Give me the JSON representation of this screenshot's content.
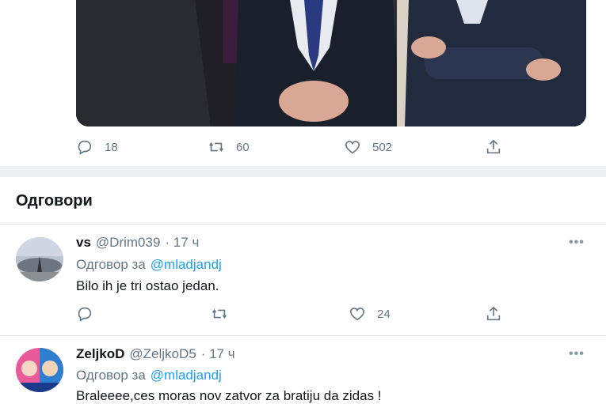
{
  "top_tweet": {
    "stats": {
      "replies": "18",
      "retweets": "60",
      "likes": "502"
    }
  },
  "section": {
    "title": "Одговори"
  },
  "replies": [
    {
      "name": "vs",
      "handle": "@Drim039",
      "time": "· 17 ч",
      "reply_prefix": "Одговор за",
      "reply_to": "@mladjandj",
      "text": "Bilo ih je tri ostao jedan.",
      "likes": "24"
    },
    {
      "name": "ZeljkoD",
      "handle": "@ZeljkoD5",
      "time": "· 17 ч",
      "reply_prefix": "Одговор за",
      "reply_to": "@mladjandj",
      "text": "Braleeee,ces moras nov zatvor za bratiju da zidas !"
    }
  ],
  "more_label": "•••",
  "colors": {
    "accent": "#1da1f2",
    "muted": "#657786",
    "text": "#14171a"
  }
}
